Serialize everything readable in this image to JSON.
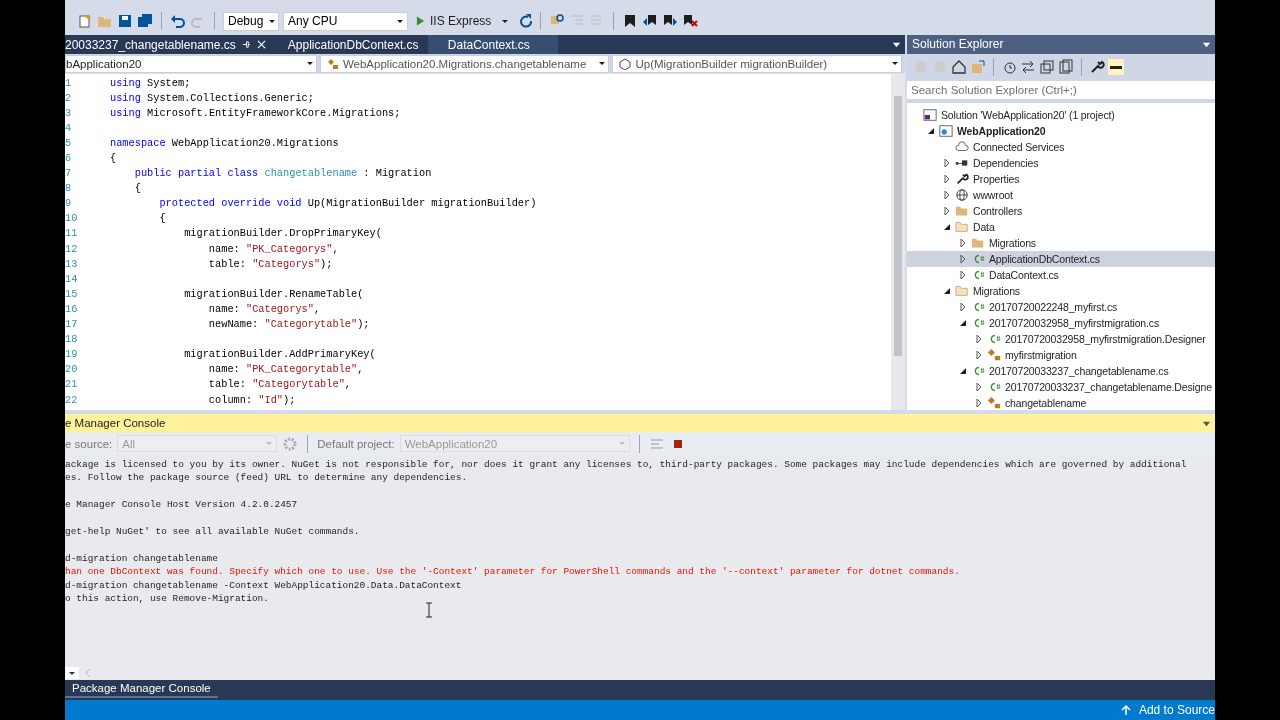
{
  "toolbar": {
    "configuration": "Debug",
    "platform": "Any CPU",
    "run_target": "IIS Express"
  },
  "editor_tabs": [
    {
      "label": "20033237_changetablename.cs",
      "selected": true
    },
    {
      "label": "ApplicationDbContext.cs",
      "selected": false
    },
    {
      "label": "DataContext.cs",
      "selected": false
    }
  ],
  "navigation_bar": {
    "project": "bApplication20",
    "type": "WebApplication20.Migrations.changetablename",
    "member": "Up(MigrationBuilder migrationBuilder)"
  },
  "code_lines": [
    {
      "number": "1",
      "segments": [
        {
          "kind": "keyword",
          "text": "using"
        },
        {
          "kind": "plain",
          "text": " System;"
        }
      ]
    },
    {
      "number": "2",
      "segments": [
        {
          "kind": "keyword",
          "text": "using"
        },
        {
          "kind": "plain",
          "text": " System.Collections.Generic;"
        }
      ]
    },
    {
      "number": "3",
      "segments": [
        {
          "kind": "keyword",
          "text": "using"
        },
        {
          "kind": "plain",
          "text": " Microsoft.EntityFrameworkCore.Migrations;"
        }
      ]
    },
    {
      "number": "4"
    },
    {
      "number": "5",
      "segments": [
        {
          "kind": "keyword",
          "text": "namespace"
        },
        {
          "kind": "plain",
          "text": " WebApplication20.Migrations"
        }
      ]
    },
    {
      "number": "6",
      "segments": [
        {
          "kind": "plain",
          "text": "{"
        }
      ]
    },
    {
      "number": "7",
      "segments": [
        {
          "kind": "keyword",
          "text": "    public partial class"
        },
        {
          "kind": "type",
          "text": " changetablename"
        },
        {
          "kind": "plain",
          "text": " : Migration"
        }
      ]
    },
    {
      "number": "8",
      "segments": [
        {
          "kind": "plain",
          "text": "    {"
        }
      ]
    },
    {
      "number": "9",
      "segments": [
        {
          "kind": "keyword",
          "text": "        protected override void"
        },
        {
          "kind": "plain",
          "text": " Up(MigrationBuilder migrationBuilder)"
        }
      ]
    },
    {
      "number": "10",
      "segments": [
        {
          "kind": "plain",
          "text": "        {"
        }
      ]
    },
    {
      "number": "11",
      "segments": [
        {
          "kind": "plain",
          "text": "            migrationBuilder.DropPrimaryKey("
        }
      ]
    },
    {
      "number": "12",
      "segments": [
        {
          "kind": "plain",
          "text": "                name: "
        },
        {
          "kind": "string",
          "text": "\"PK_Categorys\""
        },
        {
          "kind": "plain",
          "text": ","
        }
      ]
    },
    {
      "number": "13",
      "segments": [
        {
          "kind": "plain",
          "text": "                table: "
        },
        {
          "kind": "string",
          "text": "\"Categorys\""
        },
        {
          "kind": "plain",
          "text": ");"
        }
      ]
    },
    {
      "number": "14"
    },
    {
      "number": "15",
      "segments": [
        {
          "kind": "plain",
          "text": "            migrationBuilder.RenameTable("
        }
      ]
    },
    {
      "number": "16",
      "segments": [
        {
          "kind": "plain",
          "text": "                name: "
        },
        {
          "kind": "string",
          "text": "\"Categorys\""
        },
        {
          "kind": "plain",
          "text": ","
        }
      ]
    },
    {
      "number": "17",
      "segments": [
        {
          "kind": "plain",
          "text": "                newName: "
        },
        {
          "kind": "string",
          "text": "\"Categorytable\""
        },
        {
          "kind": "plain",
          "text": ");"
        }
      ]
    },
    {
      "number": "18"
    },
    {
      "number": "19",
      "segments": [
        {
          "kind": "plain",
          "text": "            migrationBuilder.AddPrimaryKey("
        }
      ]
    },
    {
      "number": "20",
      "segments": [
        {
          "kind": "plain",
          "text": "                name: "
        },
        {
          "kind": "string",
          "text": "\"PK_Categorytable\""
        },
        {
          "kind": "plain",
          "text": ","
        }
      ]
    },
    {
      "number": "21",
      "segments": [
        {
          "kind": "plain",
          "text": "                table: "
        },
        {
          "kind": "string",
          "text": "\"Categorytable\""
        },
        {
          "kind": "plain",
          "text": ","
        }
      ]
    },
    {
      "number": "22",
      "segments": [
        {
          "kind": "plain",
          "text": "                column: "
        },
        {
          "kind": "string",
          "text": "\"Id\""
        },
        {
          "kind": "plain",
          "text": ");"
        }
      ]
    }
  ],
  "solution_explorer": {
    "title": "Solution Explorer",
    "search_placeholder": "Search Solution Explorer (Ctrl+;)",
    "tree": [
      {
        "kind": "solution",
        "label": "Solution 'WebApplication20' (1 project)",
        "selected": false,
        "children": [
          {
            "kind": "project",
            "label": "WebApplication20",
            "expanded": true,
            "selected": false,
            "children": [
              {
                "kind": "cloud",
                "label": "Connected Services",
                "selected": false
              },
              {
                "kind": "dependencies",
                "label": "Dependencies",
                "expanded": false,
                "selected": false
              },
              {
                "kind": "wrench",
                "label": "Properties",
                "expanded": false,
                "selected": false
              },
              {
                "kind": "globe",
                "label": "wwwroot",
                "expanded": false,
                "selected": false
              },
              {
                "kind": "folder",
                "label": "Controllers",
                "expanded": false,
                "selected": false
              },
              {
                "kind": "folder",
                "label": "Data",
                "expanded": true,
                "selected": false,
                "children": [
                  {
                    "kind": "folder",
                    "label": "Migrations",
                    "expanded": false,
                    "selected": false
                  },
                  {
                    "kind": "csharp",
                    "label": "ApplicationDbContext.cs",
                    "expanded": false,
                    "selected": true
                  },
                  {
                    "kind": "csharp",
                    "label": "DataContext.cs",
                    "expanded": false,
                    "selected": false
                  }
                ]
              },
              {
                "kind": "folder",
                "label": "Migrations",
                "expanded": true,
                "selected": false,
                "children": [
                  {
                    "kind": "csharp",
                    "label": "20170720022248_myfirst.cs",
                    "expanded": false,
                    "selected": false
                  },
                  {
                    "kind": "csharp",
                    "label": "20170720032958_myfirstmigration.cs",
                    "expanded": true,
                    "selected": false,
                    "children": [
                      {
                        "kind": "csharp",
                        "label": "20170720032958_myfirstmigration.Designer",
                        "expanded": false,
                        "selected": false
                      },
                      {
                        "kind": "class",
                        "label": "myfirstmigration",
                        "expanded": false,
                        "selected": false
                      }
                    ]
                  },
                  {
                    "kind": "csharp",
                    "label": "20170720033237_changetablename.cs",
                    "expanded": true,
                    "selected": false,
                    "children": [
                      {
                        "kind": "csharp",
                        "label": "20170720033237_changetablename.Designe",
                        "expanded": false,
                        "selected": false
                      },
                      {
                        "kind": "class",
                        "label": "changetablename",
                        "expanded": false,
                        "selected": false
                      }
                    ]
                  }
                ]
              }
            ]
          }
        ]
      }
    ]
  },
  "console": {
    "title": "e Manager Console",
    "source_label": "e source:",
    "source": "All",
    "project_label": "Default project:",
    "project": "WebApplication20",
    "blocks": [
      [
        {
          "kind": "output",
          "text": "ackage is licensed to you by its owner. NuGet is not responsible for, nor does it grant any licenses to, third-party packages. Some packages may include dependencies which are governed by additional"
        },
        {
          "kind": "output",
          "text": "es. Follow the package source (feed) URL to determine any dependencies."
        }
      ],
      [
        {
          "kind": "output",
          "text": "e Manager Console Host Version 4.2.0.2457"
        }
      ],
      [
        {
          "kind": "output",
          "text": "get-help NuGet' to see all available NuGet commands."
        }
      ],
      [
        {
          "kind": "output",
          "text": "d-migration changetablename"
        },
        {
          "kind": "error",
          "text": "han one DbContext was found. Specify which one to use. Use the '-Context' parameter for PowerShell commands and the '--context' parameter for dotnet commands."
        },
        {
          "kind": "output",
          "text": "d-migration changetablename -Context WebApplication20.Data.DataContext"
        },
        {
          "kind": "output",
          "text": "o this action, use Remove-Migration."
        }
      ]
    ]
  },
  "bottom_tabs": [
    {
      "label": "Package Manager Console",
      "selected": true
    }
  ],
  "status_bar": {
    "action": "Add to Source"
  }
}
